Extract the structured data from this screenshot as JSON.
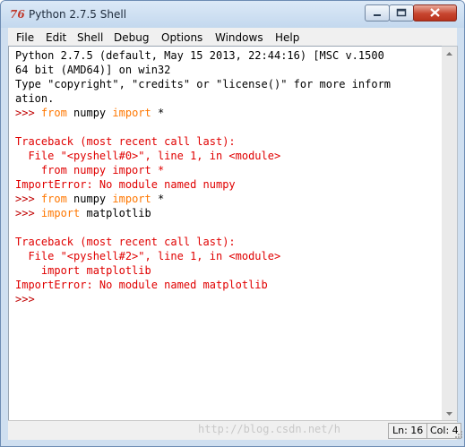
{
  "window": {
    "title": "Python 2.7.5 Shell",
    "app_icon": "76",
    "buttons": {
      "minimize_icon": "minimize-icon",
      "maximize_icon": "maximize-icon",
      "close_icon": "close-icon"
    }
  },
  "menu": [
    "File",
    "Edit",
    "Shell",
    "Debug",
    "Options",
    "Windows",
    "Help"
  ],
  "shell_lines": [
    [
      {
        "t": "Python 2.7.5 (default, May 15 2013, 22:44:16) [MSC v.1500",
        "c": ""
      }
    ],
    [
      {
        "t": "64 bit (AMD64)] on win32",
        "c": ""
      }
    ],
    [
      {
        "t": "Type \"copyright\", \"credits\" or \"license()\" for more inform",
        "c": ""
      }
    ],
    [
      {
        "t": "ation.",
        "c": ""
      }
    ],
    [
      {
        "t": ">>> ",
        "c": "prompt"
      },
      {
        "t": "from",
        "c": "kw"
      },
      {
        "t": " numpy ",
        "c": ""
      },
      {
        "t": "import",
        "c": "kw"
      },
      {
        "t": " *",
        "c": ""
      }
    ],
    [],
    [
      {
        "t": "Traceback (most recent call last):",
        "c": "err"
      }
    ],
    [
      {
        "t": "  File \"<pyshell#0>\", line 1, in <module>",
        "c": "err"
      }
    ],
    [
      {
        "t": "    from numpy import *",
        "c": "err"
      }
    ],
    [
      {
        "t": "ImportError: No module named numpy",
        "c": "err"
      }
    ],
    [
      {
        "t": ">>> ",
        "c": "prompt"
      },
      {
        "t": "from",
        "c": "kw"
      },
      {
        "t": " numpy ",
        "c": ""
      },
      {
        "t": "import",
        "c": "kw"
      },
      {
        "t": " *",
        "c": ""
      }
    ],
    [
      {
        "t": ">>> ",
        "c": "prompt"
      },
      {
        "t": "import",
        "c": "kw"
      },
      {
        "t": " matplotlib",
        "c": ""
      }
    ],
    [],
    [
      {
        "t": "Traceback (most recent call last):",
        "c": "err"
      }
    ],
    [
      {
        "t": "  File \"<pyshell#2>\", line 1, in <module>",
        "c": "err"
      }
    ],
    [
      {
        "t": "    import matplotlib",
        "c": "err"
      }
    ],
    [
      {
        "t": "ImportError: No module named matplotlib",
        "c": "err"
      }
    ],
    [
      {
        "t": ">>> ",
        "c": "prompt"
      }
    ]
  ],
  "status": {
    "ln": "Ln: 16",
    "col": "Col: 4",
    "watermark": "http://blog.csdn.net/h"
  },
  "colors": {
    "keyword": "#ff7700",
    "error": "#e00000",
    "prompt": "#c00000"
  }
}
